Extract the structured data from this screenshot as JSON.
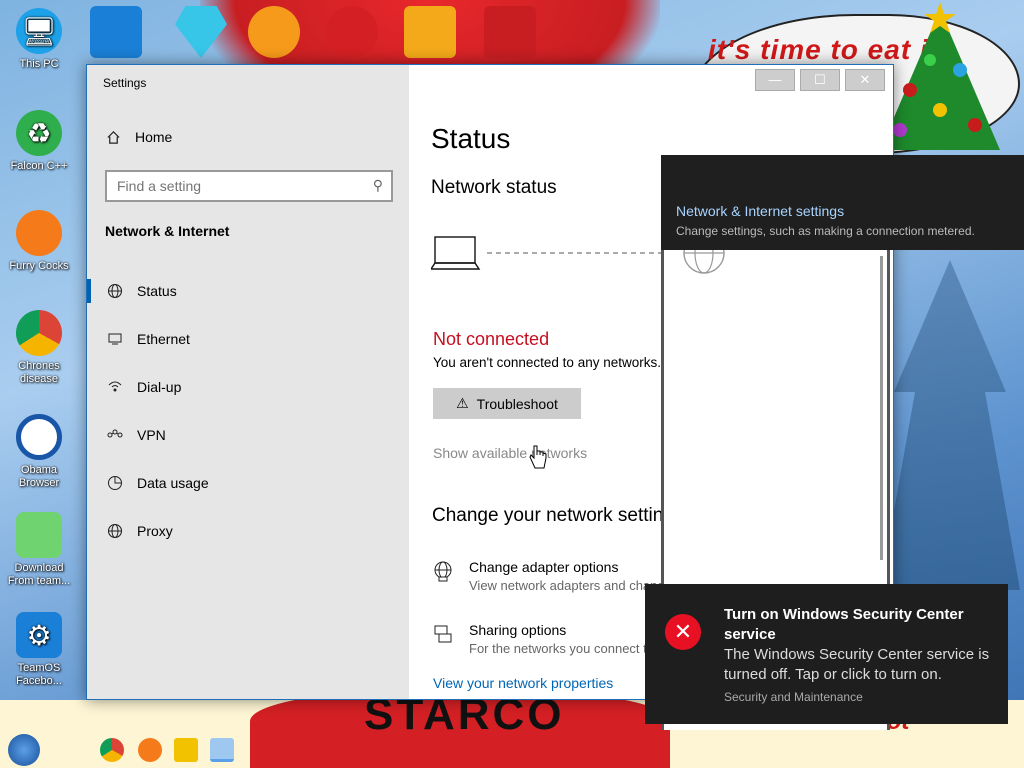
{
  "wallpaper": {
    "banner_text": "it's time to eat it",
    "bottom_text": "STARCO",
    "signature": "vmcbot"
  },
  "desktop_icons": [
    {
      "label": "This PC",
      "icon": "computer-icon"
    },
    {
      "label": "Falcon C++",
      "icon": "recycle-icon"
    },
    {
      "label": "Furry Cocks",
      "icon": "firefox-icon"
    },
    {
      "label": "Chrones disease",
      "icon": "chrome-icon"
    },
    {
      "label": "Obama Browser",
      "icon": "obama-logo-icon"
    },
    {
      "label": "Download From team...",
      "icon": "notepad-icon"
    },
    {
      "label": "TeamOS Facebo...",
      "icon": "gear-icon"
    }
  ],
  "window": {
    "title": "Settings",
    "minimize": "—",
    "maximize": "☐",
    "close": "✕"
  },
  "sidebar": {
    "home_label": "Home",
    "search_placeholder": "Find a setting",
    "section_title": "Network & Internet",
    "items": [
      {
        "label": "Status",
        "icon": "globe-icon",
        "active": true
      },
      {
        "label": "Ethernet",
        "icon": "ethernet-icon",
        "active": false
      },
      {
        "label": "Dial-up",
        "icon": "dialup-icon",
        "active": false
      },
      {
        "label": "VPN",
        "icon": "vpn-icon",
        "active": false
      },
      {
        "label": "Data usage",
        "icon": "pie-icon",
        "active": false
      },
      {
        "label": "Proxy",
        "icon": "globe-icon",
        "active": false
      }
    ]
  },
  "main": {
    "page_title": "Status",
    "network_status_title": "Network status",
    "status": "Not connected",
    "status_desc": "You aren't connected to any networks.",
    "troubleshoot_label": "Troubleshoot",
    "show_networks": "Show available networks",
    "change_title": "Change your network settings",
    "options": [
      {
        "title": "Change adapter options",
        "desc": "View network adapters and change connection settings.",
        "icon": "adapter-icon"
      },
      {
        "title": "Sharing options",
        "desc": "For the networks you connect to, decide what you want to share.",
        "icon": "sharing-icon"
      }
    ],
    "view_properties": "View your network properties"
  },
  "flyout": {
    "title": "Network & Internet settings",
    "desc": "Change settings, such as making a connection metered."
  },
  "toast": {
    "title": "Turn on Windows Security Center service",
    "body": "The Windows Security Center service is turned off. Tap or click to turn on.",
    "source": "Security and Maintenance"
  }
}
